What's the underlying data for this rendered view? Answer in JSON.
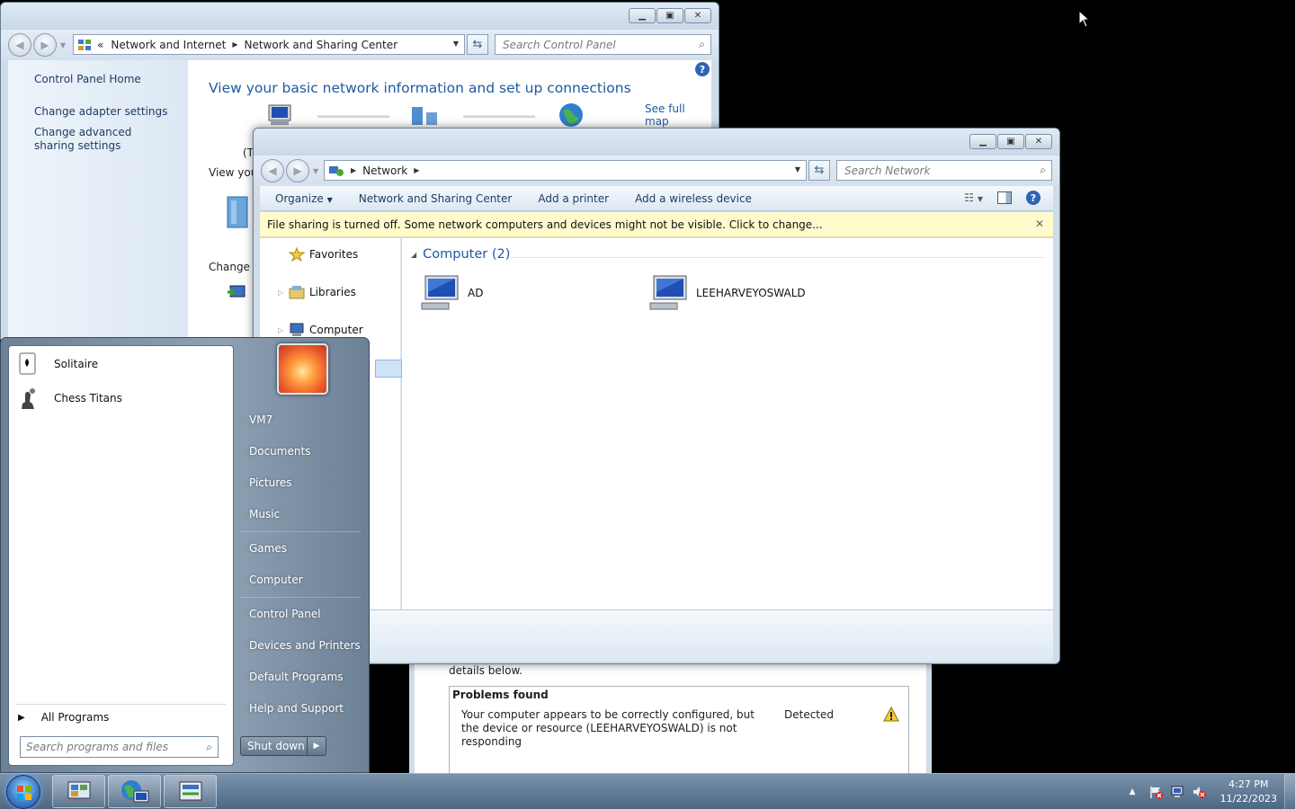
{
  "control_panel": {
    "breadcrumb_overflow": "«",
    "breadcrumb": [
      "Network and Internet",
      "Network and Sharing Center"
    ],
    "search_placeholder": "Search Control Panel",
    "links": [
      "Control Panel Home",
      "Change adapter settings",
      "Change advanced sharing settings"
    ],
    "heading": "View your basic network information and set up connections",
    "see_full_map": "See full map",
    "partial_text_1": "(T",
    "partial_text_2": "View you",
    "partial_text_3": "Change y",
    "help": "?"
  },
  "network": {
    "breadcrumb": [
      "Network"
    ],
    "search_placeholder": "Search Network",
    "commands": [
      "Organize",
      "Network and Sharing Center",
      "Add a printer",
      "Add a wireless device"
    ],
    "infobar": "File sharing is turned off. Some network computers and devices might not be visible. Click to change...",
    "nav": [
      "Favorites",
      "Libraries",
      "Computer"
    ],
    "group_header": "Computer (2)",
    "items": [
      "AD",
      "LEEHARVEYOSWALD"
    ]
  },
  "troubleshooter": {
    "hint": "details below.",
    "problems_title": "Problems found",
    "problem_desc": "Your computer appears to be correctly configured, but the device or resource (LEEHARVEYOSWALD) is not responding",
    "problem_status": "Detected"
  },
  "start_menu": {
    "programs": [
      "Solitaire",
      "Chess Titans"
    ],
    "all_programs": "All Programs",
    "search_placeholder": "Search programs and files",
    "right_items": [
      "VM7",
      "Documents",
      "Pictures",
      "Music",
      "Games",
      "Computer",
      "Control Panel",
      "Devices and Printers",
      "Default Programs",
      "Help and Support"
    ],
    "shutdown": "Shut down"
  },
  "taskbar": {
    "time": "4:27 PM",
    "date": "11/22/2023"
  },
  "icons": {
    "tray_up": "chevron-up-icon",
    "tray": [
      "action-center-flag-icon",
      "network-icon",
      "volume-muted-icon"
    ]
  }
}
